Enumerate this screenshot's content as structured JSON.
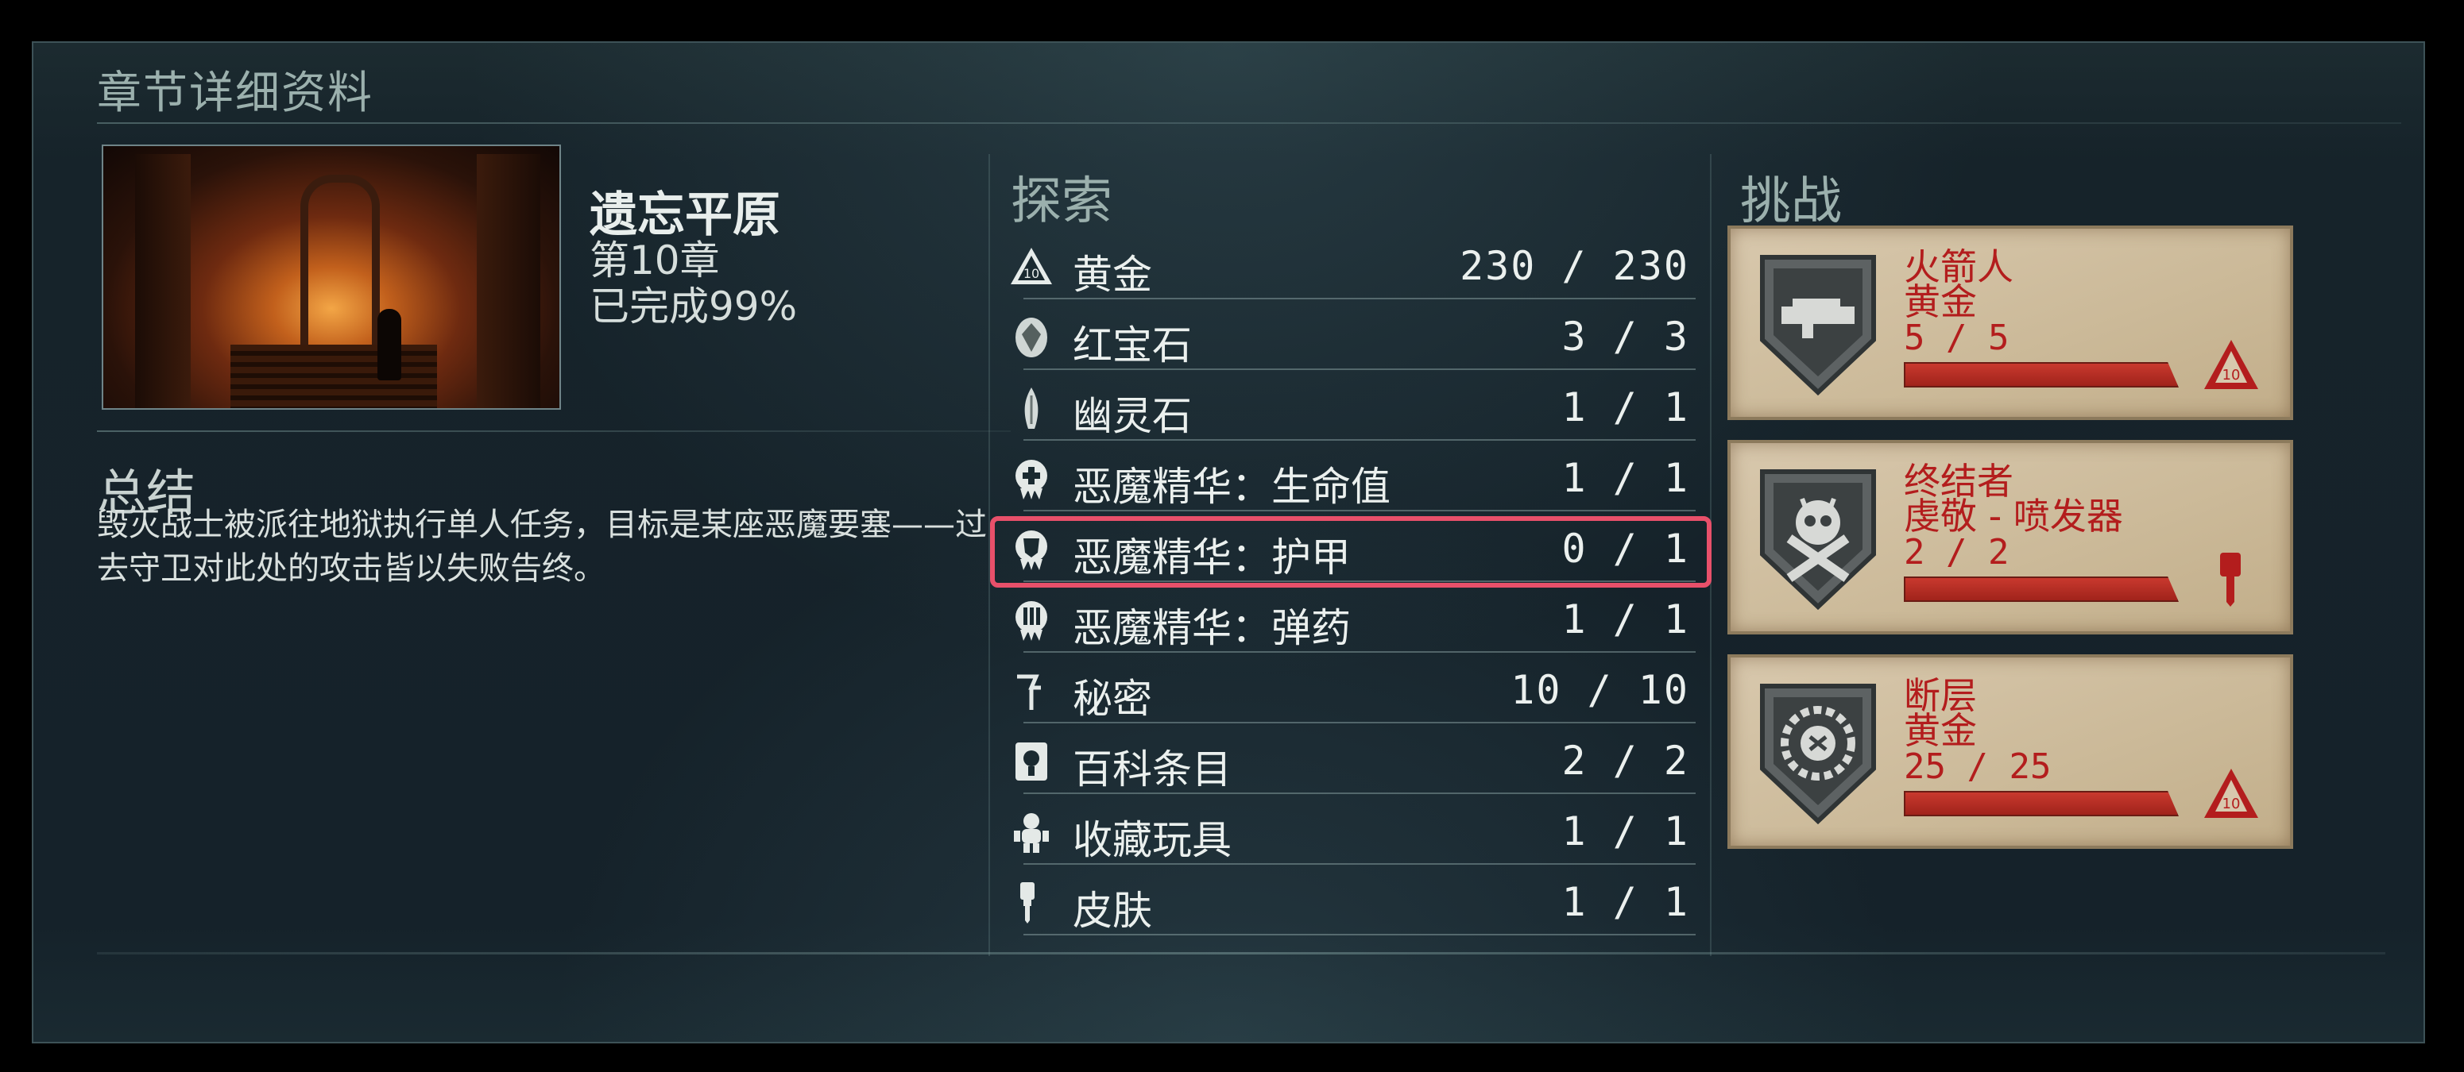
{
  "panel_title": "章节详细资料",
  "chapter": {
    "name": "遗忘平原",
    "number": "第10章",
    "completion": "已完成99%"
  },
  "summary": {
    "title": "总结",
    "text": "毁灭战士被派往地狱执行单人任务，目标是某座恶魔要塞——过去守卫对此处的攻击皆以失败告终。"
  },
  "explore": {
    "title": "探索",
    "items": [
      {
        "label": "黄金",
        "value": "230 / 230",
        "icon": "gold-icon"
      },
      {
        "label": "红宝石",
        "value": "3 / 3",
        "icon": "ruby-icon"
      },
      {
        "label": "幽灵石",
        "value": "1 / 1",
        "icon": "wraithstone-icon"
      },
      {
        "label": "恶魔精华：生命值",
        "value": "1 / 1",
        "icon": "demon-essence-health-icon"
      },
      {
        "label": "恶魔精华：护甲",
        "value": "0 / 1",
        "icon": "demon-essence-armor-icon",
        "selected": true
      },
      {
        "label": "恶魔精华：弹药",
        "value": "1 / 1",
        "icon": "demon-essence-ammo-icon"
      },
      {
        "label": "秘密",
        "value": "10 / 10",
        "icon": "secret-icon"
      },
      {
        "label": "百科条目",
        "value": "2 / 2",
        "icon": "codex-icon"
      },
      {
        "label": "收藏玩具",
        "value": "1 / 1",
        "icon": "toy-icon"
      },
      {
        "label": "皮肤",
        "value": "1 / 1",
        "icon": "skin-icon"
      }
    ]
  },
  "challenges": {
    "title": "挑战",
    "items": [
      {
        "name": "火箭人",
        "reward": "黄金",
        "progress": "5 / 5",
        "fill": 1.0,
        "icon": "rocket-launcher-shield-icon",
        "reward_icon": "gold-reward-icon"
      },
      {
        "name": "终结者",
        "reward": "虔敬 - 喷发器",
        "progress": "2 / 2",
        "fill": 1.0,
        "icon": "skull-crossbones-shield-icon",
        "reward_icon": "paint-brush-icon"
      },
      {
        "name": "断层",
        "reward": "黄金",
        "progress": "25 / 25",
        "fill": 1.0,
        "icon": "sawblade-shield-icon",
        "reward_icon": "gold-reward-icon"
      }
    ]
  },
  "colors": {
    "selection": "#e8506a",
    "challenge_text": "#b31d1d",
    "card_bg": "#d8c8ad"
  }
}
